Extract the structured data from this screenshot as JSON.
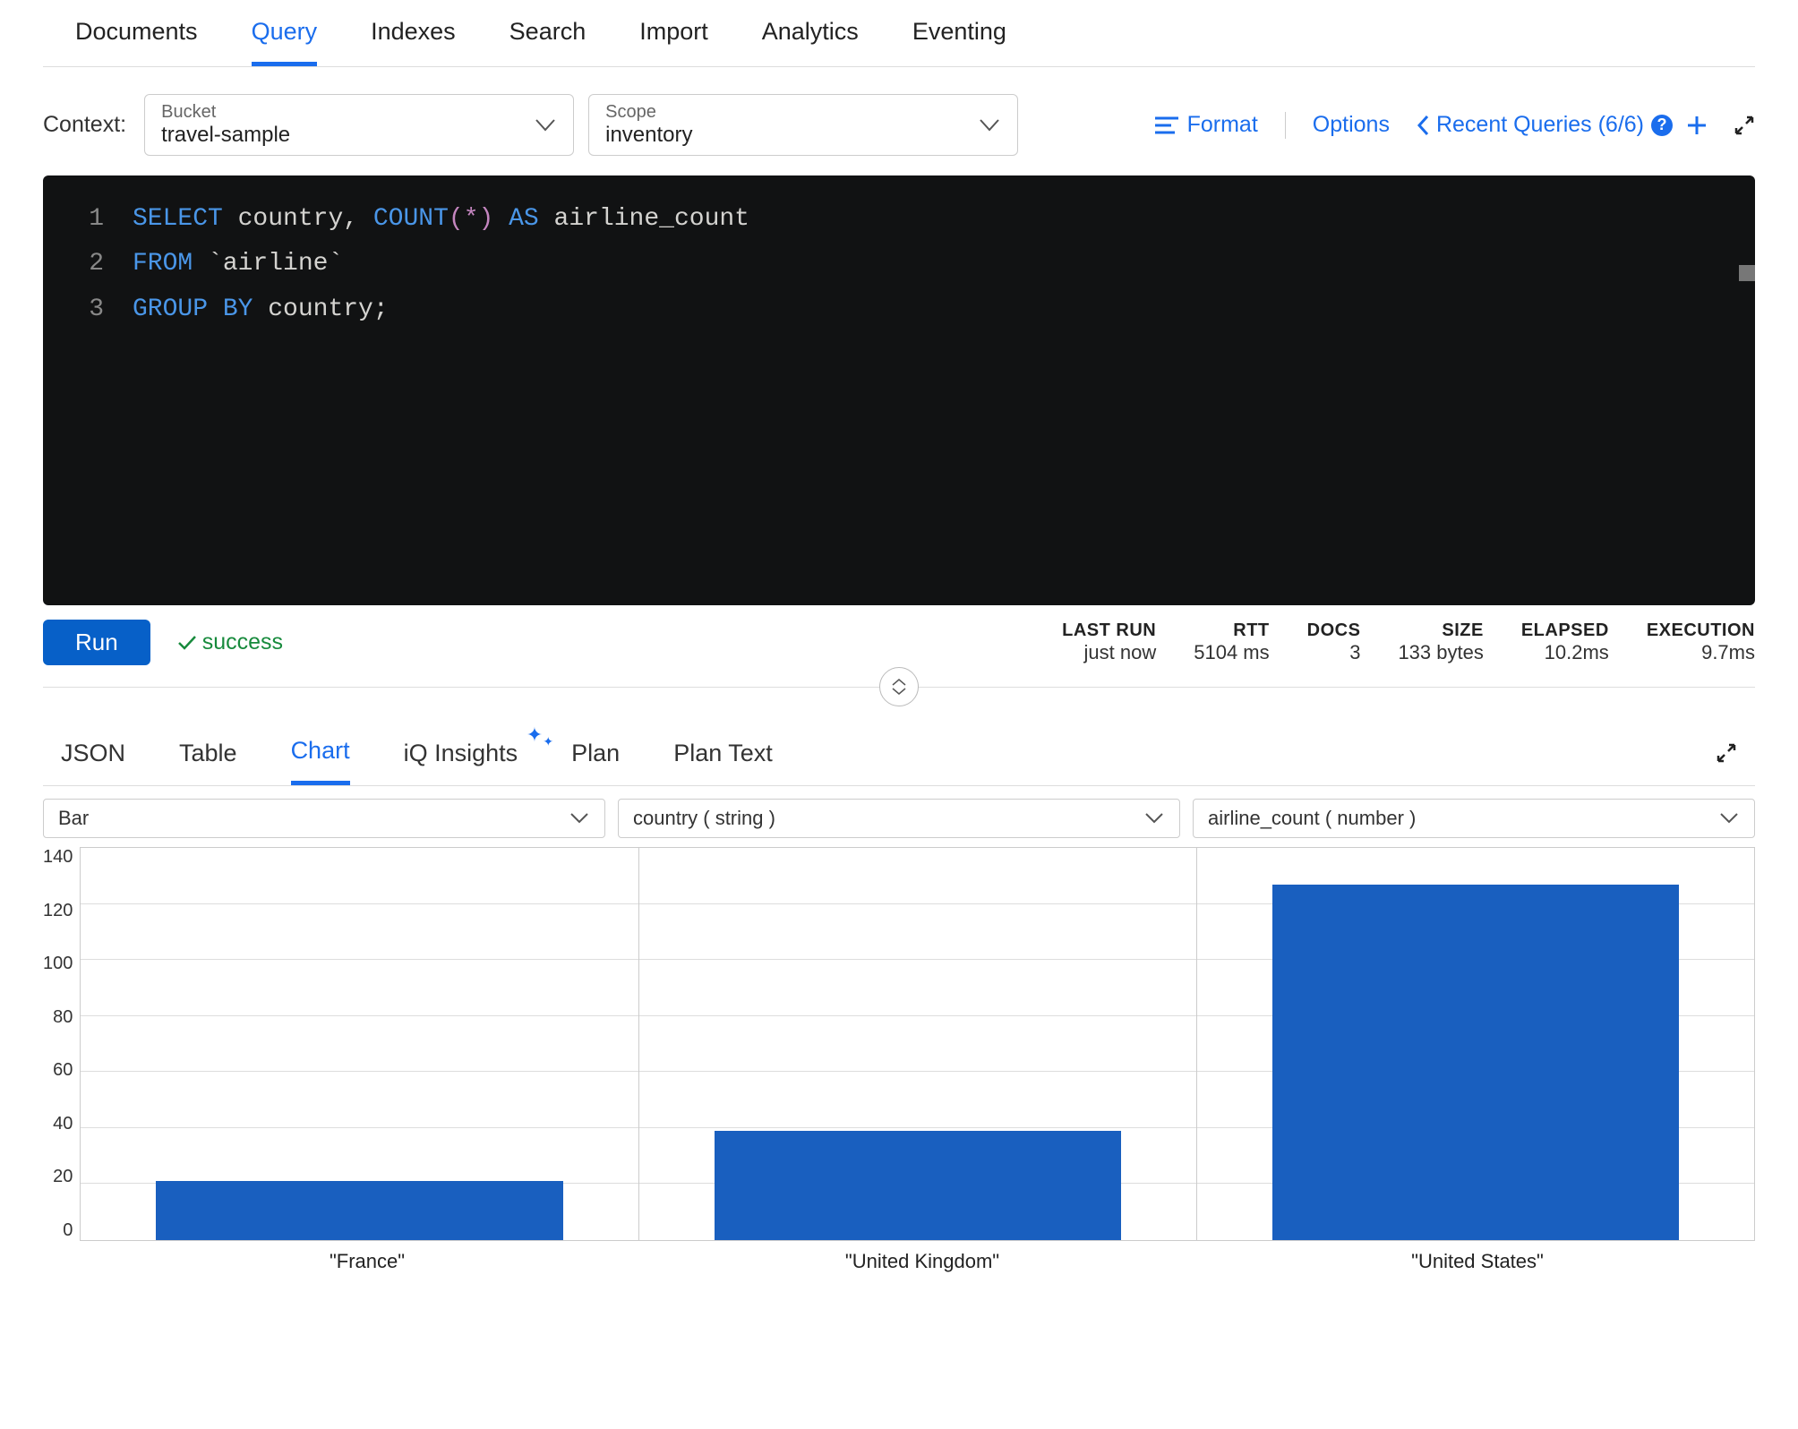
{
  "top_tabs": [
    "Documents",
    "Query",
    "Indexes",
    "Search",
    "Import",
    "Analytics",
    "Eventing"
  ],
  "top_active": "Query",
  "context": {
    "label": "Context:",
    "bucket": {
      "label": "Bucket",
      "value": "travel-sample"
    },
    "scope": {
      "label": "Scope",
      "value": "inventory"
    }
  },
  "toolbar": {
    "format": "Format",
    "options": "Options",
    "recent": "Recent Queries (6/6)",
    "recent_badge": "?"
  },
  "editor": {
    "lines": [
      {
        "n": "1",
        "tokens": [
          {
            "t": "SELECT",
            "c": "kw"
          },
          {
            "t": " country, ",
            "c": ""
          },
          {
            "t": "COUNT",
            "c": "kw"
          },
          {
            "t": "(",
            "c": "pn"
          },
          {
            "t": "*",
            "c": "pn"
          },
          {
            "t": ")",
            "c": "pn"
          },
          {
            "t": " ",
            "c": ""
          },
          {
            "t": "AS",
            "c": "kw"
          },
          {
            "t": " airline_count",
            "c": ""
          }
        ]
      },
      {
        "n": "2",
        "tokens": [
          {
            "t": "FROM",
            "c": "kw"
          },
          {
            "t": " `airline`",
            "c": ""
          }
        ]
      },
      {
        "n": "3",
        "tokens": [
          {
            "t": "GROUP",
            "c": "kw"
          },
          {
            "t": " ",
            "c": ""
          },
          {
            "t": "BY",
            "c": "kw"
          },
          {
            "t": " country;",
            "c": ""
          }
        ]
      }
    ]
  },
  "run": {
    "button": "Run",
    "status": "success",
    "stats": [
      {
        "label": "LAST RUN",
        "val": "just now"
      },
      {
        "label": "RTT",
        "val": "5104 ms"
      },
      {
        "label": "DOCS",
        "val": "3"
      },
      {
        "label": "SIZE",
        "val": "133 bytes"
      },
      {
        "label": "ELAPSED",
        "val": "10.2ms"
      },
      {
        "label": "EXECUTION",
        "val": "9.7ms"
      }
    ]
  },
  "result_tabs": [
    "JSON",
    "Table",
    "Chart",
    "iQ Insights",
    "Plan",
    "Plan Text"
  ],
  "result_active": "Chart",
  "chart_selects": {
    "type": "Bar",
    "x": "country ( string )",
    "y": "airline_count ( number )"
  },
  "chart_data": {
    "type": "bar",
    "categories": [
      "\"France\"",
      "\"United Kingdom\"",
      "\"United States\""
    ],
    "values": [
      21,
      39,
      127
    ],
    "title": "",
    "xlabel": "",
    "ylabel": "",
    "ylim": [
      0,
      140
    ],
    "yticks": [
      0,
      20,
      40,
      60,
      80,
      100,
      120,
      140
    ]
  }
}
